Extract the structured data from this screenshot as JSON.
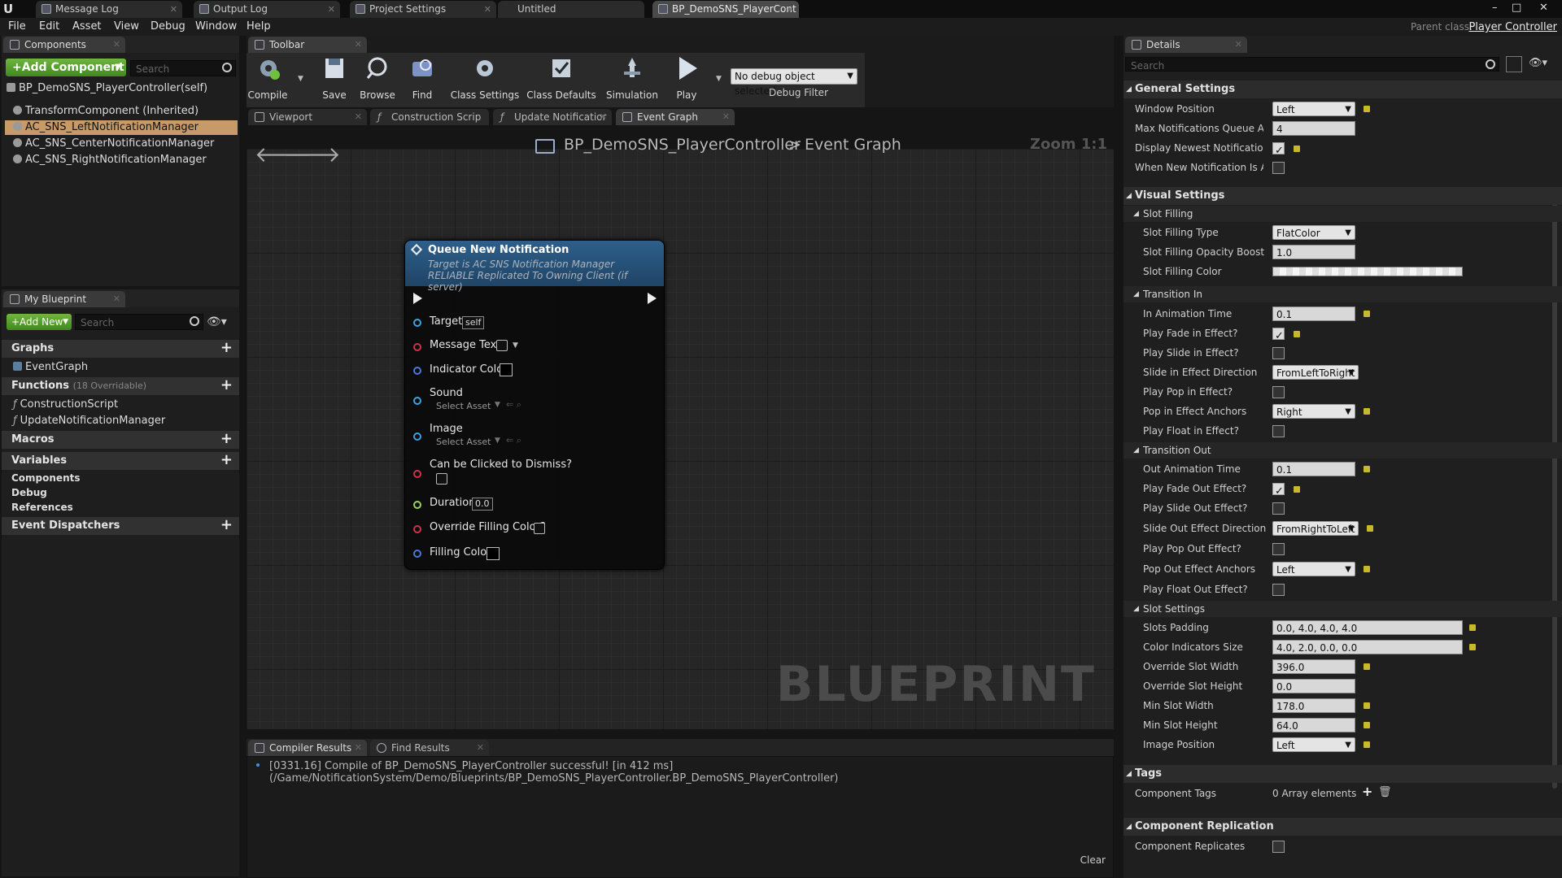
{
  "titlebar": {
    "tabs": [
      "Message Log",
      "Output Log",
      "Project Settings",
      "Untitled",
      "BP_DemoSNS_PlayerCont"
    ],
    "window_controls": [
      "–",
      "□",
      "✕"
    ]
  },
  "menu": {
    "items": [
      "File",
      "Edit",
      "Asset",
      "View",
      "Debug",
      "Window",
      "Help"
    ],
    "parent_class_label": "Parent class:",
    "parent_class_value": "Player Controller"
  },
  "components": {
    "tab": "Components",
    "add_button": "+Add Component",
    "search_placeholder": "Search",
    "root": "BP_DemoSNS_PlayerController(self)",
    "items": [
      "TransformComponent (Inherited)",
      "AC_SNS_LeftNotificationManager",
      "AC_SNS_CenterNotificationManager",
      "AC_SNS_RightNotificationManager"
    ]
  },
  "my_blueprint": {
    "tab": "My Blueprint",
    "add_button": "+Add New",
    "search_placeholder": "Search",
    "graphs_header": "Graphs",
    "graphs": [
      "EventGraph"
    ],
    "functions_header": "Functions",
    "functions_count": "(18 Overridable)",
    "functions": [
      "ConstructionScript",
      "UpdateNotificationManager"
    ],
    "macros_header": "Macros",
    "variables_header": "Variables",
    "variables": [
      "Components",
      "Debug",
      "References"
    ],
    "dispatchers_header": "Event Dispatchers"
  },
  "toolbar": {
    "tab": "Toolbar",
    "buttons": [
      "Compile",
      "Save",
      "Browse",
      "Find",
      "Class Settings",
      "Class Defaults",
      "Simulation",
      "Play"
    ],
    "debug_object": "No debug object selected",
    "debug_filter": "Debug Filter"
  },
  "editor_tabs": [
    "Viewport",
    "Construction Scrip",
    "Update Notificatior",
    "Event Graph"
  ],
  "graph": {
    "breadcrumb_root": "BP_DemoSNS_PlayerController",
    "breadcrumb_sep": ">",
    "breadcrumb_current": "Event Graph",
    "zoom": "Zoom 1:1",
    "watermark": "BLUEPRINT",
    "node": {
      "title": "Queue New Notification",
      "subtitle1": "Target is AC SNS Notification Manager",
      "subtitle2": "RELIABLE Replicated To Owning Client (if server)",
      "pins": {
        "target": "Target",
        "target_value": "self",
        "message_text": "Message Text",
        "indicator_color": "Indicator Color",
        "sound": "Sound",
        "sound_value": "Select Asset",
        "image": "Image",
        "image_value": "Select Asset",
        "dismiss": "Can be Clicked to Dismiss?",
        "duration": "Duration",
        "duration_value": "0.0",
        "override": "Override Filling Color?",
        "filling": "Filling Color"
      }
    }
  },
  "bottom": {
    "tabs": [
      "Compiler Results",
      "Find Results"
    ],
    "log": "[0331.16] Compile of BP_DemoSNS_PlayerController successful! [in 412 ms] (/Game/NotificationSystem/Demo/Blueprints/BP_DemoSNS_PlayerController.BP_DemoSNS_PlayerController)",
    "clear": "Clear"
  },
  "details": {
    "tab": "Details",
    "search_placeholder": "Search",
    "general": {
      "header": "General Settings",
      "window_position": "Window Position",
      "window_position_value": "Left",
      "max_queue": "Max Notifications Queue Amount",
      "max_queue_value": "4",
      "display_newest": "Display Newest Notification on To",
      "when_new": "When New Notification Is Added F"
    },
    "visual": {
      "header": "Visual Settings",
      "slot_filling": "Slot Filling",
      "slot_filling_type": "Slot Filling Type",
      "slot_filling_type_value": "FlatColor",
      "opacity_boost": "Slot Filling Opacity Boost",
      "opacity_boost_value": "1.0",
      "filling_color": "Slot Filling Color",
      "transition_in": "Transition In",
      "in_time": "In Animation Time",
      "in_time_value": "0.1",
      "fade_in": "Play Fade in Effect?",
      "slide_in": "Play Slide in Effect?",
      "slide_in_dir": "Slide in Effect Direction",
      "slide_in_dir_value": "FromLeftToRight",
      "pop_in": "Play Pop in Effect?",
      "pop_in_anchors": "Pop in Effect Anchors",
      "pop_in_anchors_value": "Right",
      "float_in": "Play Float in Effect?",
      "transition_out": "Transition Out",
      "out_time": "Out Animation Time",
      "out_time_value": "0.1",
      "fade_out": "Play Fade Out Effect?",
      "slide_out": "Play Slide Out Effect?",
      "slide_out_dir": "Slide Out Effect Direction",
      "slide_out_dir_value": "FromRightToLeft",
      "pop_out": "Play Pop Out Effect?",
      "pop_out_anchors": "Pop Out Effect Anchors",
      "pop_out_anchors_value": "Left",
      "float_out": "Play Float Out Effect?",
      "slot_settings": "Slot Settings",
      "slots_padding": "Slots Padding",
      "slots_padding_value": "0.0, 4.0, 4.0, 4.0",
      "indicators_size": "Color Indicators Size",
      "indicators_size_value": "4.0, 2.0, 0.0, 0.0",
      "override_width": "Override Slot Width",
      "override_width_value": "396.0",
      "override_height": "Override Slot Height",
      "override_height_value": "0.0",
      "min_width": "Min Slot Width",
      "min_width_value": "178.0",
      "min_height": "Min Slot Height",
      "min_height_value": "64.0",
      "image_position": "Image Position",
      "image_position_value": "Left"
    },
    "tags": {
      "header": "Tags",
      "component_tags": "Component Tags",
      "component_tags_value": "0 Array elements"
    },
    "replication": {
      "header": "Component Replication",
      "replicates": "Component Replicates"
    }
  },
  "colors": {
    "accent_green": "#4a9a26",
    "selection": "#c79a69",
    "node_header": "#2e5f8a",
    "reset_arrow": "#c8b82c"
  }
}
